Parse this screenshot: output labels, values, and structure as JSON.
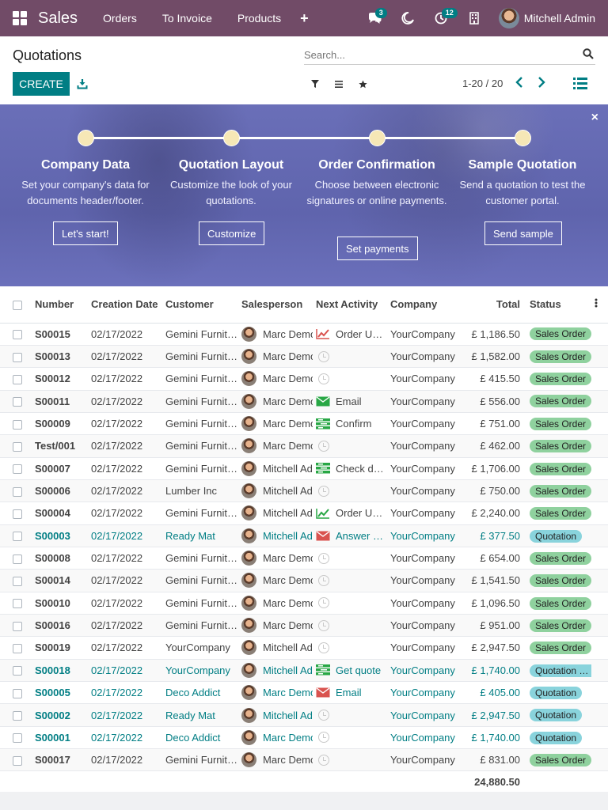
{
  "navbar": {
    "app_name": "Sales",
    "menus": [
      "Orders",
      "To Invoice",
      "Products"
    ],
    "plus_label": "+",
    "messages_count": "3",
    "activities_count": "12",
    "user_name": "Mitchell Admin",
    "background_color": "#714b67",
    "badge_color": "#017e84"
  },
  "control_panel": {
    "breadcrumb": "Quotations",
    "search_placeholder": "Search...",
    "create_label": "CREATE",
    "pager": "1-20 / 20",
    "accent_color": "#017e84"
  },
  "onboarding": {
    "close": "×",
    "steps": [
      {
        "title": "Company Data",
        "description": "Set your company's data for documents header/footer.",
        "button": "Let's start!"
      },
      {
        "title": "Quotation Layout",
        "description": "Customize the look of your quotations.",
        "button": "Customize"
      },
      {
        "title": "Order Confirmation",
        "description": "Choose between electronic signatures or online payments.",
        "button": "Set payments"
      },
      {
        "title": "Sample Quotation",
        "description": "Send a quotation to test the customer portal.",
        "button": "Send sample"
      }
    ]
  },
  "table": {
    "columns": [
      "Number",
      "Creation Date",
      "Customer",
      "Salesperson",
      "Next Activity",
      "Company",
      "Total",
      "Status"
    ],
    "rows": [
      {
        "number": "S00015",
        "date": "02/17/2022",
        "customer": "Gemini Furniture",
        "salesperson": "Marc Demo",
        "activity_icon": "chart-up-red-icon",
        "activity": "Order Upsell",
        "company": "YourCompany",
        "total": "£ 1,186.50",
        "status": "Sales Order",
        "kind": "order"
      },
      {
        "number": "S00013",
        "date": "02/17/2022",
        "customer": "Gemini Furniture",
        "salesperson": "Marc Demo",
        "activity_icon": "clock-icon",
        "activity": "",
        "company": "YourCompany",
        "total": "£ 1,582.00",
        "status": "Sales Order",
        "kind": "order"
      },
      {
        "number": "S00012",
        "date": "02/17/2022",
        "customer": "Gemini Furniture",
        "salesperson": "Marc Demo",
        "activity_icon": "clock-icon",
        "activity": "",
        "company": "YourCompany",
        "total": "£ 415.50",
        "status": "Sales Order",
        "kind": "order"
      },
      {
        "number": "S00011",
        "date": "02/17/2022",
        "customer": "Gemini Furniture",
        "salesperson": "Marc Demo",
        "activity_icon": "email-green-icon",
        "activity": "Email",
        "company": "YourCompany",
        "total": "£ 556.00",
        "status": "Sales Order",
        "kind": "order"
      },
      {
        "number": "S00009",
        "date": "02/17/2022",
        "customer": "Gemini Furniture",
        "salesperson": "Marc Demo",
        "activity_icon": "tasks-green-icon",
        "activity": "Confirm",
        "company": "YourCompany",
        "total": "£ 751.00",
        "status": "Sales Order",
        "kind": "order"
      },
      {
        "number": "Test/001",
        "date": "02/17/2022",
        "customer": "Gemini Furniture",
        "salesperson": "Marc Demo",
        "activity_icon": "clock-icon",
        "activity": "",
        "company": "YourCompany",
        "total": "£ 462.00",
        "status": "Sales Order",
        "kind": "order"
      },
      {
        "number": "S00007",
        "date": "02/17/2022",
        "customer": "Gemini Furniture",
        "salesperson": "Mitchell Admin",
        "activity_icon": "tasks-green-icon",
        "activity": "Check delivery",
        "company": "YourCompany",
        "total": "£ 1,706.00",
        "status": "Sales Order",
        "kind": "order"
      },
      {
        "number": "S00006",
        "date": "02/17/2022",
        "customer": "Lumber Inc",
        "salesperson": "Mitchell Admin",
        "activity_icon": "clock-icon",
        "activity": "",
        "company": "YourCompany",
        "total": "£ 750.00",
        "status": "Sales Order",
        "kind": "order"
      },
      {
        "number": "S00004",
        "date": "02/17/2022",
        "customer": "Gemini Furniture",
        "salesperson": "Mitchell Admin",
        "activity_icon": "chart-up-green-icon",
        "activity": "Order Upsell",
        "company": "YourCompany",
        "total": "£ 2,240.00",
        "status": "Sales Order",
        "kind": "order"
      },
      {
        "number": "S00003",
        "date": "02/17/2022",
        "customer": "Ready Mat",
        "salesperson": "Mitchell Admin",
        "activity_icon": "email-red-icon",
        "activity": "Answer Questions",
        "company": "YourCompany",
        "total": "£ 377.50",
        "status": "Quotation",
        "kind": "quote"
      },
      {
        "number": "S00008",
        "date": "02/17/2022",
        "customer": "Gemini Furniture",
        "salesperson": "Marc Demo",
        "activity_icon": "clock-icon",
        "activity": "",
        "company": "YourCompany",
        "total": "£ 654.00",
        "status": "Sales Order",
        "kind": "order"
      },
      {
        "number": "S00014",
        "date": "02/17/2022",
        "customer": "Gemini Furniture",
        "salesperson": "Marc Demo",
        "activity_icon": "clock-icon",
        "activity": "",
        "company": "YourCompany",
        "total": "£ 1,541.50",
        "status": "Sales Order",
        "kind": "order"
      },
      {
        "number": "S00010",
        "date": "02/17/2022",
        "customer": "Gemini Furniture",
        "salesperson": "Marc Demo",
        "activity_icon": "clock-icon",
        "activity": "",
        "company": "YourCompany",
        "total": "£ 1,096.50",
        "status": "Sales Order",
        "kind": "order"
      },
      {
        "number": "S00016",
        "date": "02/17/2022",
        "customer": "Gemini Furniture",
        "salesperson": "Marc Demo",
        "activity_icon": "clock-icon",
        "activity": "",
        "company": "YourCompany",
        "total": "£ 951.00",
        "status": "Sales Order",
        "kind": "order"
      },
      {
        "number": "S00019",
        "date": "02/17/2022",
        "customer": "YourCompany",
        "salesperson": "Mitchell Admin",
        "activity_icon": "clock-icon",
        "activity": "",
        "company": "YourCompany",
        "total": "£ 2,947.50",
        "status": "Sales Order",
        "kind": "order"
      },
      {
        "number": "S00018",
        "date": "02/17/2022",
        "customer": "YourCompany",
        "salesperson": "Mitchell Admin",
        "activity_icon": "tasks-green-icon",
        "activity": "Get quote",
        "company": "YourCompany",
        "total": "£ 1,740.00",
        "status": "Quotation Sent",
        "kind": "quote"
      },
      {
        "number": "S00005",
        "date": "02/17/2022",
        "customer": "Deco Addict",
        "salesperson": "Marc Demo",
        "activity_icon": "email-red-icon",
        "activity": "Email",
        "company": "YourCompany",
        "total": "£ 405.00",
        "status": "Quotation",
        "kind": "quote"
      },
      {
        "number": "S00002",
        "date": "02/17/2022",
        "customer": "Ready Mat",
        "salesperson": "Mitchell Admin",
        "activity_icon": "clock-icon",
        "activity": "",
        "company": "YourCompany",
        "total": "£ 2,947.50",
        "status": "Quotation",
        "kind": "quote"
      },
      {
        "number": "S00001",
        "date": "02/17/2022",
        "customer": "Deco Addict",
        "salesperson": "Marc Demo",
        "activity_icon": "clock-icon",
        "activity": "",
        "company": "YourCompany",
        "total": "£ 1,740.00",
        "status": "Quotation",
        "kind": "quote"
      },
      {
        "number": "S00017",
        "date": "02/17/2022",
        "customer": "Gemini Furniture",
        "salesperson": "Marc Demo",
        "activity_icon": "clock-icon",
        "activity": "",
        "company": "YourCompany",
        "total": "£ 831.00",
        "status": "Sales Order",
        "kind": "order"
      }
    ],
    "grand_total": "24,880.50",
    "status_colors": {
      "order": "#8fd19e",
      "quote": "#89d3dc"
    }
  }
}
